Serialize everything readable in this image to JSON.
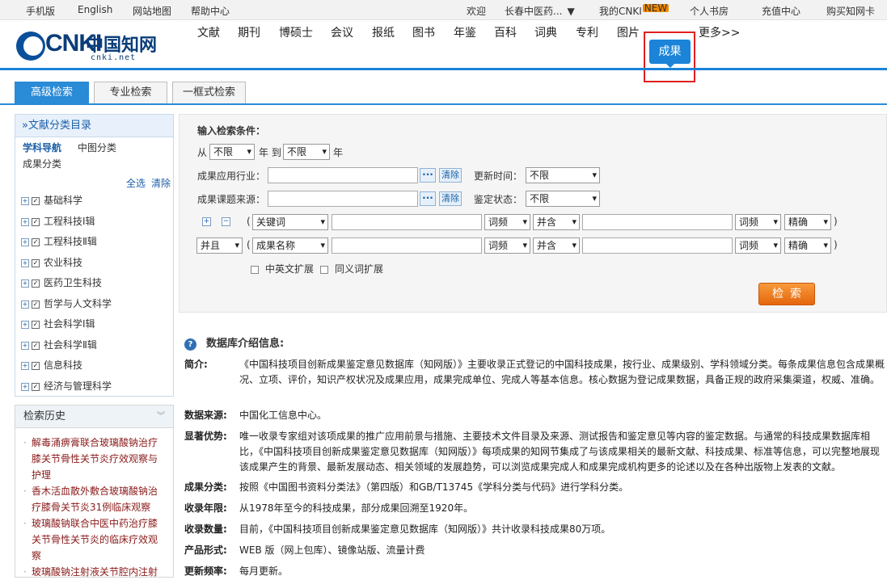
{
  "topbar": {
    "mobile": "手机版",
    "english": "English",
    "sitemap": "网站地图",
    "help": "帮助中心",
    "welcome": "欢迎",
    "org": "长春中医药...",
    "mycnki": "我的CNKI",
    "new_badge": "NEW",
    "bookshelf": "个人书房",
    "recharge": "充值中心",
    "buy_card": "购买知网卡"
  },
  "logo": {
    "nki": "CNKI",
    "cn": "中国知网",
    "net": "cnki.net"
  },
  "nav": {
    "items": [
      "文献",
      "期刊",
      "博硕士",
      "会议",
      "报纸",
      "图书",
      "年鉴",
      "百科",
      "词典",
      "专利",
      "图片"
    ],
    "active": "成果",
    "more": "更多>>"
  },
  "tabs": [
    "高级检索",
    "专业检索",
    "一框式检索"
  ],
  "sidebar": {
    "title": "»文献分类目录",
    "nav1": "学科导航",
    "nav2": "中图分类",
    "nav3": "成果分类",
    "select_all": "全选",
    "clear": "清除",
    "items": [
      "基础科学",
      "工程科技Ⅰ辑",
      "工程科技Ⅱ辑",
      "农业科技",
      "医药卫生科技",
      "哲学与人文科学",
      "社会科学Ⅰ辑",
      "社会科学Ⅱ辑",
      "信息科技",
      "经济与管理科学"
    ]
  },
  "history": {
    "title": "检索历史",
    "items": [
      "解毒涌痹膏联合玻璃酸钠治疗膝关节骨性关节炎疗效观察与护理",
      "香木活血散外敷合玻璃酸钠治疗膝骨关节炎31例临床观察",
      "玻璃酸钠联合中医中药治疗膝关节骨性关节炎的临床疗效观察",
      "玻璃酸钠注射液关节腔内注射"
    ]
  },
  "form": {
    "heading": "输入检索条件：",
    "from": "从",
    "year_from": "不限",
    "year_label": "年 到",
    "year_to": "不限",
    "year_end": "年",
    "industry_label": "成果应用行业：",
    "source_label": "成果课题来源：",
    "clear_btn": "清除",
    "dots": "···",
    "update_label": "更新时间：",
    "update_value": "不限",
    "appraisal_label": "鉴定状态：",
    "appraisal_value": "不限",
    "row1_field": "关键词",
    "row2_op": "并且",
    "row2_field": "成果名称",
    "freq": "词频",
    "and": "并含",
    "exact": "精确",
    "paren_open": "(",
    "paren_close": ")",
    "plus": "+",
    "minus": "−",
    "ext_cn_en": "中英文扩展",
    "ext_syn": "同义词扩展",
    "search": "检索"
  },
  "info": {
    "title": "数据库介绍信息:",
    "rows": [
      {
        "k": "简介:",
        "v": "《中国科技项目创新成果鉴定意见数据库（知网版）》主要收录正式登记的中国科技成果，按行业、成果级别、学科领域分类。每条成果信息包含成果概况、立项、评价，知识产权状况及成果应用，成果完成单位、完成人等基本信息。核心数据为登记成果数据，具备正规的政府采集渠道，权威、准确。"
      },
      {
        "k": "数据来源:",
        "v": "中国化工信息中心。"
      },
      {
        "k": "显著优势:",
        "v": "唯一收录专家组对该项成果的推广应用前景与措施、主要技术文件目录及来源、测试报告和鉴定意见等内容的鉴定数据。与通常的科技成果数据库相比，《中国科技项目创新成果鉴定意见数据库（知网版）》每项成果的知网节集成了与该成果相关的最新文献、科技成果、标准等信息，可以完整地展现该成果产生的背景、最新发展动态、相关领域的发展趋势，可以浏览成果完成人和成果完成机构更多的论述以及在各种出版物上发表的文献。"
      },
      {
        "k": "成果分类:",
        "v": "按照《中国图书资料分类法》（第四版）和GB/T13745《学科分类与代码》进行学科分类。"
      },
      {
        "k": "收录年限:",
        "v": "从1978年至今的科技成果，部分成果回溯至1920年。"
      },
      {
        "k": "收录数量:",
        "v": "目前，《中国科技项目创新成果鉴定意见数据库（知网版）》共计收录科技成果80万项。"
      },
      {
        "k": "产品形式:",
        "v": "WEB 版（网上包库）、镜像站版、流量计费"
      },
      {
        "k": "更新频率:",
        "v": "每月更新。"
      }
    ]
  },
  "colors": {
    "primary": "#1b84d8",
    "search_btn": "#ef7a1e",
    "highlight_box": "#e02020"
  }
}
